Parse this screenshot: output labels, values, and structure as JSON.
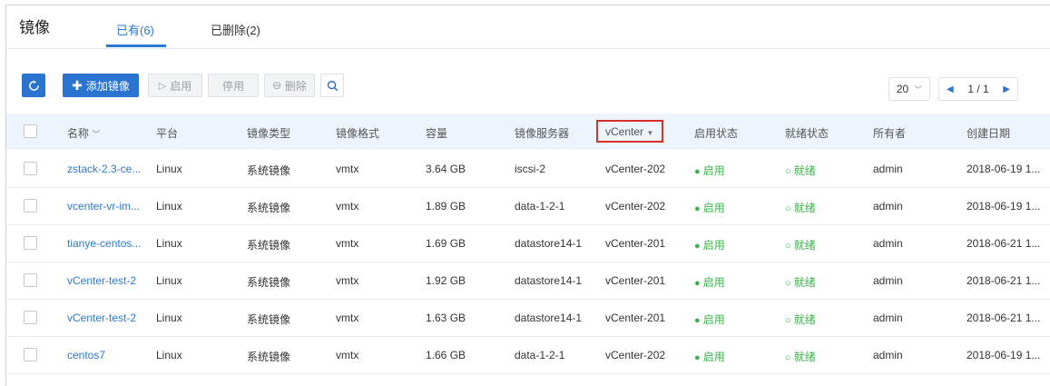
{
  "header": {
    "title": "镜像",
    "tabs": [
      {
        "label": "已有(6)",
        "active": true
      },
      {
        "label": "已删除(2)",
        "active": false
      }
    ]
  },
  "toolbar": {
    "add_label": "添加镜像",
    "start_label": "启用",
    "stop_label": "停用",
    "delete_label": "删除",
    "accent_color": "#2b73d1"
  },
  "pagination": {
    "page_size": "20",
    "page_info": "1 / 1"
  },
  "table": {
    "headers": [
      "名称",
      "平台",
      "镜像类型",
      "镜像格式",
      "容量",
      "镜像服务器",
      "vCenter",
      "启用状态",
      "就绪状态",
      "所有者",
      "创建日期"
    ],
    "rows": [
      [
        "zstack-2.3-ce...",
        "Linux",
        "系统镜像",
        "vmtx",
        "3.64 GB",
        "iscsi-2",
        "vCenter-202",
        "启用",
        "就绪",
        "admin",
        "2018-06-19 1..."
      ],
      [
        "vcenter-vr-im...",
        "Linux",
        "系统镜像",
        "vmtx",
        "1.89 GB",
        "data-1-2-1",
        "vCenter-202",
        "启用",
        "就绪",
        "admin",
        "2018-06-19 1..."
      ],
      [
        "tianye-centos...",
        "Linux",
        "系统镜像",
        "vmtx",
        "1.69 GB",
        "datastore14-1",
        "vCenter-201",
        "启用",
        "就绪",
        "admin",
        "2018-06-21 1..."
      ],
      [
        "vCenter-test-2",
        "Linux",
        "系统镜像",
        "vmtx",
        "1.92 GB",
        "datastore14-1",
        "vCenter-201",
        "启用",
        "就绪",
        "admin",
        "2018-06-21 1..."
      ],
      [
        "vCenter-test-2",
        "Linux",
        "系统镜像",
        "vmtx",
        "1.63 GB",
        "datastore14-1",
        "vCenter-201",
        "启用",
        "就绪",
        "admin",
        "2018-06-21 1..."
      ],
      [
        "centos7",
        "Linux",
        "系统镜像",
        "vmtx",
        "1.66 GB",
        "data-1-2-1",
        "vCenter-202",
        "启用",
        "就绪",
        "admin",
        "2018-06-19 1..."
      ]
    ],
    "status_color": "#3bb24a",
    "highlight_color": "#d9302b"
  }
}
